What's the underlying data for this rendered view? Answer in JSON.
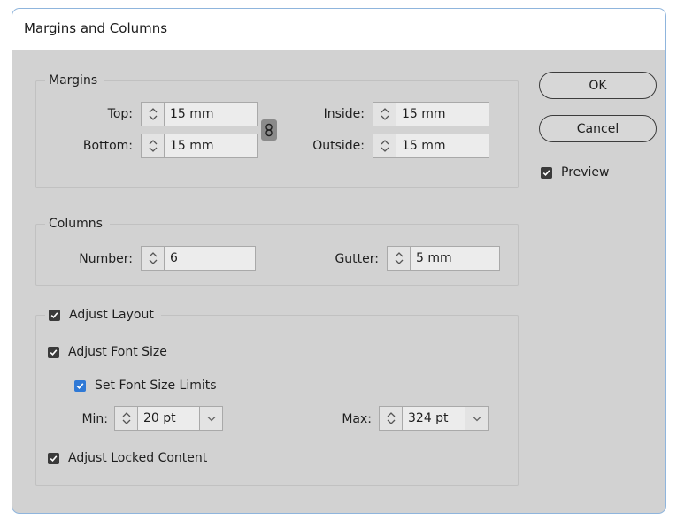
{
  "dialog": {
    "title": "Margins and Columns"
  },
  "margins": {
    "legend": "Margins",
    "top": {
      "label": "Top:",
      "value": "15 mm"
    },
    "bottom": {
      "label": "Bottom:",
      "value": "15 mm"
    },
    "inside": {
      "label": "Inside:",
      "value": "15 mm"
    },
    "outside": {
      "label": "Outside:",
      "value": "15 mm"
    },
    "link_icon": "chain-link-icon"
  },
  "columns": {
    "legend": "Columns",
    "number": {
      "label": "Number:",
      "value": "6"
    },
    "gutter": {
      "label": "Gutter:",
      "value": "5 mm"
    }
  },
  "layout": {
    "adjust_layout": {
      "label": "Adjust Layout",
      "checked": true
    },
    "adjust_font_size": {
      "label": "Adjust Font Size",
      "checked": true
    },
    "set_font_size_limits": {
      "label": "Set Font Size Limits",
      "checked": true
    },
    "min": {
      "label": "Min:",
      "value": "20 pt"
    },
    "max": {
      "label": "Max:",
      "value": "324 pt"
    },
    "adjust_locked_content": {
      "label": "Adjust Locked Content",
      "checked": true
    }
  },
  "buttons": {
    "ok": "OK",
    "cancel": "Cancel"
  },
  "preview": {
    "label": "Preview",
    "checked": true
  },
  "colors": {
    "dialog_bg": "#d2d2d2",
    "checkbox_dark": "#3a3a3a",
    "checkbox_accent": "#2f79d6"
  }
}
